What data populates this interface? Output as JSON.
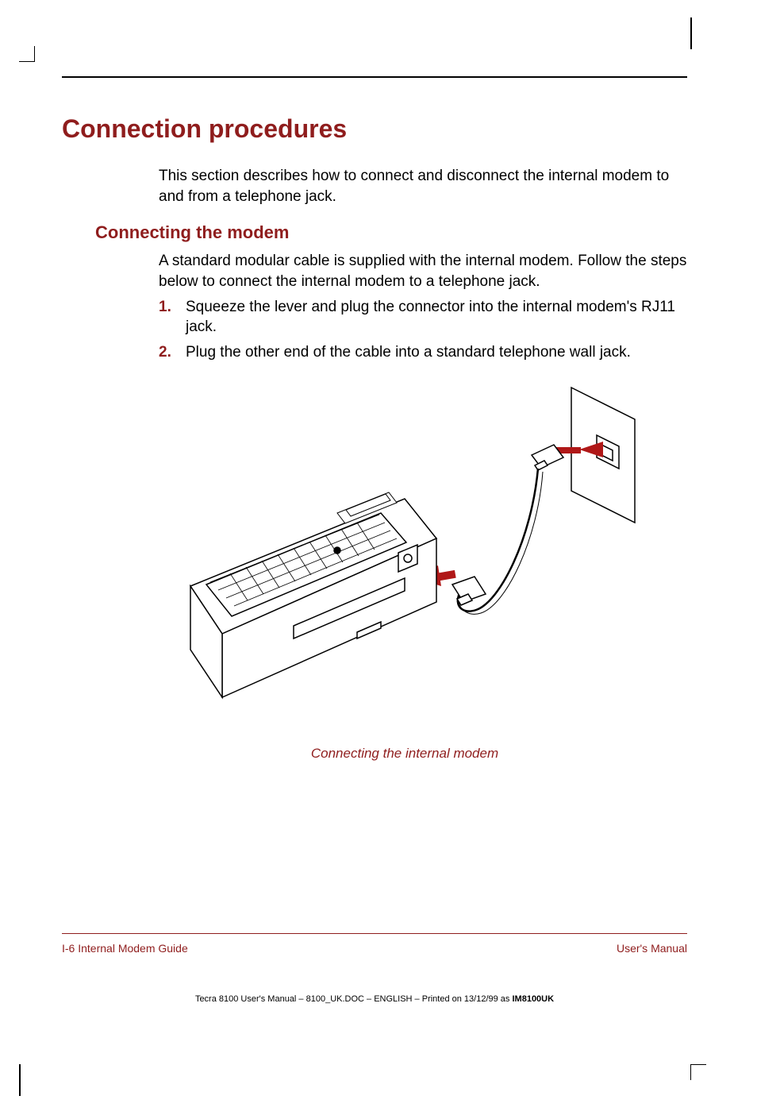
{
  "heading": "Connection procedures",
  "intro": "This section describes how to connect and disconnect the internal modem to and from a telephone jack.",
  "subheading": "Connecting the modem",
  "body": "A standard modular cable is supplied with the internal modem. Follow the steps below to connect the internal modem to a telephone jack.",
  "steps": [
    {
      "num": "1.",
      "text": "Squeeze the lever and plug the connector into the internal modem's RJ11 jack."
    },
    {
      "num": "2.",
      "text": "Plug the other end of the cable into a standard telephone wall jack."
    }
  ],
  "figure_caption": "Connecting the internal modem",
  "footer": {
    "left": "I-6  Internal Modem Guide",
    "right": "User's Manual"
  },
  "imprint": {
    "prefix": "Tecra 8100 User's Manual  – 8100_UK.DOC – ENGLISH – Printed on 13/12/99 as ",
    "code": "IM8100UK"
  }
}
